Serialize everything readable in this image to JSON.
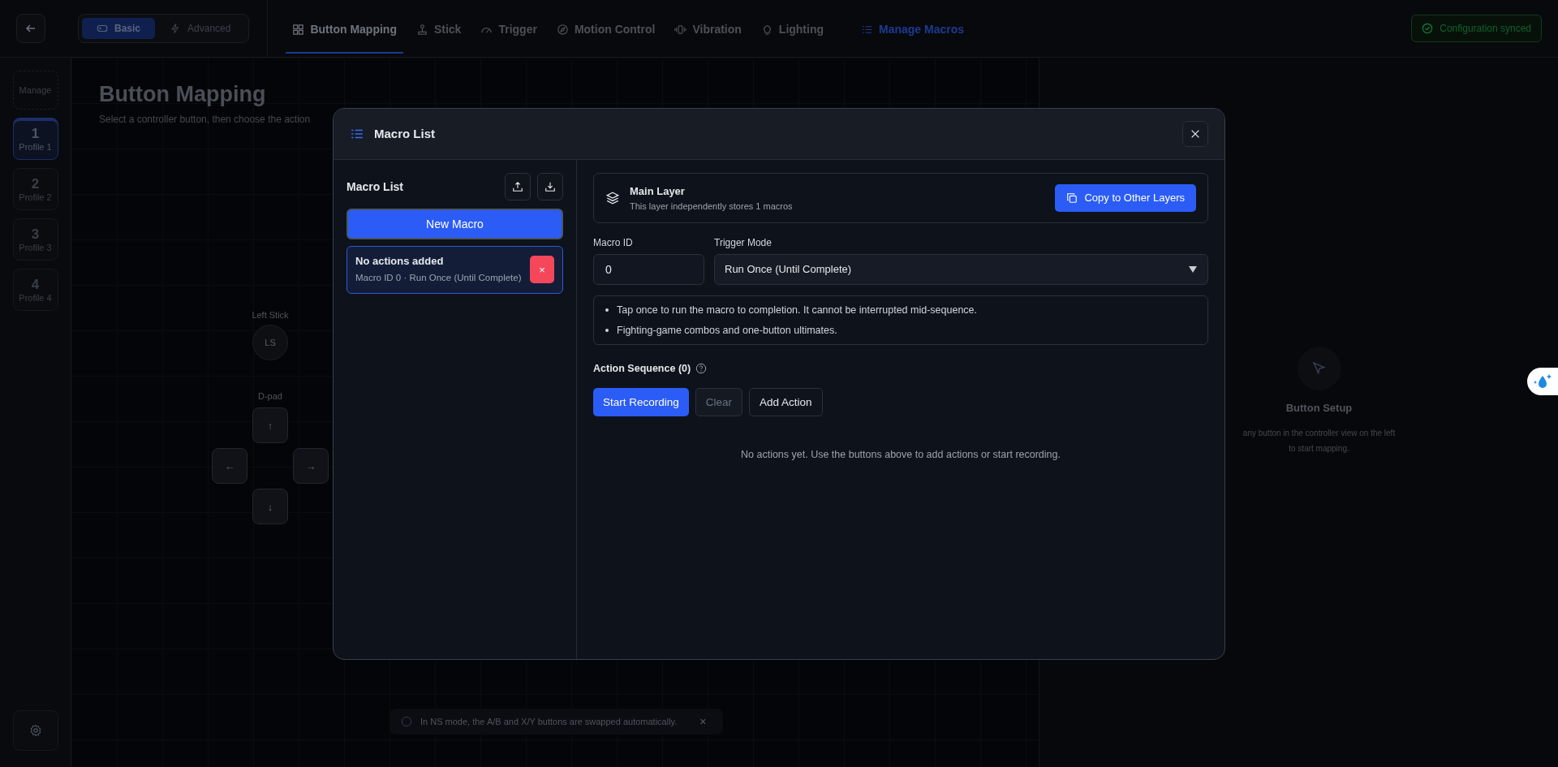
{
  "mode_switch": [
    {
      "label": "Basic",
      "selected": true,
      "kind": "gamepad"
    },
    {
      "label": "Advanced",
      "selected": false,
      "kind": "bolt"
    }
  ],
  "tabs": [
    {
      "label": "Button Mapping",
      "selected": true,
      "kind": "grid",
      "accent": false
    },
    {
      "label": "Stick",
      "selected": false,
      "kind": "stick",
      "accent": false
    },
    {
      "label": "Trigger",
      "selected": false,
      "kind": "gauge",
      "accent": false
    },
    {
      "label": "Motion Control",
      "selected": false,
      "kind": "compass",
      "accent": false
    },
    {
      "label": "Vibration",
      "selected": false,
      "kind": "vibration",
      "accent": false
    },
    {
      "label": "Lighting",
      "selected": false,
      "kind": "bulb",
      "accent": false
    },
    {
      "label": "Manage Macros",
      "selected": false,
      "kind": "list",
      "accent": true
    }
  ],
  "sync_status": "Configuration synced",
  "sidebar": {
    "manage": "Manage",
    "profiles": [
      {
        "number": "1",
        "label": "Profile 1",
        "selected": true
      },
      {
        "number": "2",
        "label": "Profile 2",
        "selected": false
      },
      {
        "number": "3",
        "label": "Profile 3",
        "selected": false
      },
      {
        "number": "4",
        "label": "Profile 4",
        "selected": false
      }
    ]
  },
  "page": {
    "title": "Button Mapping",
    "subtitle": "Select a controller button, then choose the action",
    "left_stick_label": "Left Stick",
    "left_stick": "LS",
    "dpad_label": "D-pad",
    "dpad": {
      "up": "↑",
      "left": "←",
      "right": "→",
      "down": "↓"
    },
    "setup": {
      "title": "Button Setup",
      "text": "any button in the controller view on the left to start mapping."
    },
    "notice": "In NS mode, the A/B and X/Y buttons are swapped automatically.",
    "notice_close": "×"
  },
  "modal": {
    "title": "Macro List",
    "list_title": "Macro List",
    "new_button": "New Macro",
    "macros": [
      {
        "title": "No actions added",
        "meta": "Macro ID 0 · Run Once (Until Complete)",
        "delete": "×",
        "selected": true
      }
    ],
    "layer": {
      "title": "Main Layer",
      "text": "This layer independently stores 1 macros",
      "copy_button": "Copy to Other Layers"
    },
    "macro_id": {
      "label": "Macro ID",
      "value": "0"
    },
    "trigger_mode": {
      "label": "Trigger Mode",
      "value": "Run Once (Until Complete)"
    },
    "hints": [
      "Tap once to run the macro to completion. It cannot be interrupted mid-sequence.",
      "Fighting-game combos and one-button ultimates."
    ],
    "sequence_title": "Action Sequence (0)",
    "actions": [
      {
        "label": "Start Recording",
        "kind": "primary",
        "disabled": false
      },
      {
        "label": "Clear",
        "kind": "secondary",
        "disabled": true
      },
      {
        "label": "Add Action",
        "kind": "secondary",
        "disabled": false
      }
    ],
    "empty_text": "No actions yet. Use the buttons above to add actions or start recording."
  }
}
